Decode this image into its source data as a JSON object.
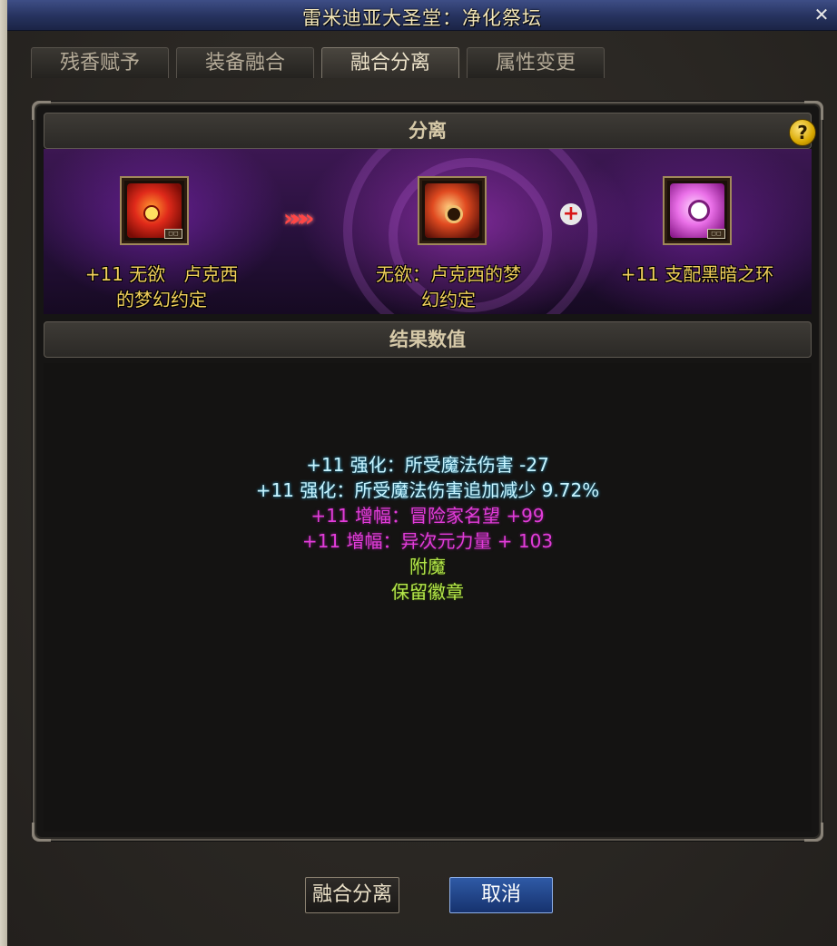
{
  "window": {
    "title": "雷米迪亚大圣堂：净化祭坛",
    "close_icon": "close-icon"
  },
  "tabs": [
    {
      "label": "残香赋予",
      "active": false
    },
    {
      "label": "装备融合",
      "active": false
    },
    {
      "label": "融合分离",
      "active": true
    },
    {
      "label": "属性变更",
      "active": false
    }
  ],
  "separation": {
    "header": "分离",
    "help_label": "?",
    "source_item": {
      "icon": "red-helmet-icon",
      "name_line1": "+11 无欲　卢克西",
      "name_line2": "的梦幻约定"
    },
    "arrow_label": "»»»",
    "result_item": {
      "icon": "red-helmet-icon",
      "name_line1": "无欲：卢克西的梦",
      "name_line2": "幻约定"
    },
    "plus_label": "+",
    "extracted_item": {
      "icon": "pink-dark-ring-icon",
      "name_line1": "+11 支配黑暗之环"
    }
  },
  "results": {
    "header": "结果数值",
    "lines": [
      {
        "text": "+11 强化：所受魔法伤害 -27",
        "color": "cyan"
      },
      {
        "text": "+11 强化：所受魔法伤害追加减少 9.72%",
        "color": "cyan"
      },
      {
        "text": "+11 增幅：冒险家名望 +99",
        "color": "pink"
      },
      {
        "text": "+11 增幅：异次元力量 + 103",
        "color": "pink"
      },
      {
        "text": "附魔",
        "color": "green"
      },
      {
        "text": "保留徽章",
        "color": "green"
      }
    ]
  },
  "buttons": {
    "fuse_label": "融合分离",
    "cancel_label": "取消"
  },
  "colors": {
    "title_bar": "#26325e",
    "item_name": "#f1cf5c",
    "cyan_text": "#c7f4ff",
    "pink_text": "#e23cd9",
    "green_text": "#b4e64a",
    "cancel_button": "#2f5aa6"
  }
}
